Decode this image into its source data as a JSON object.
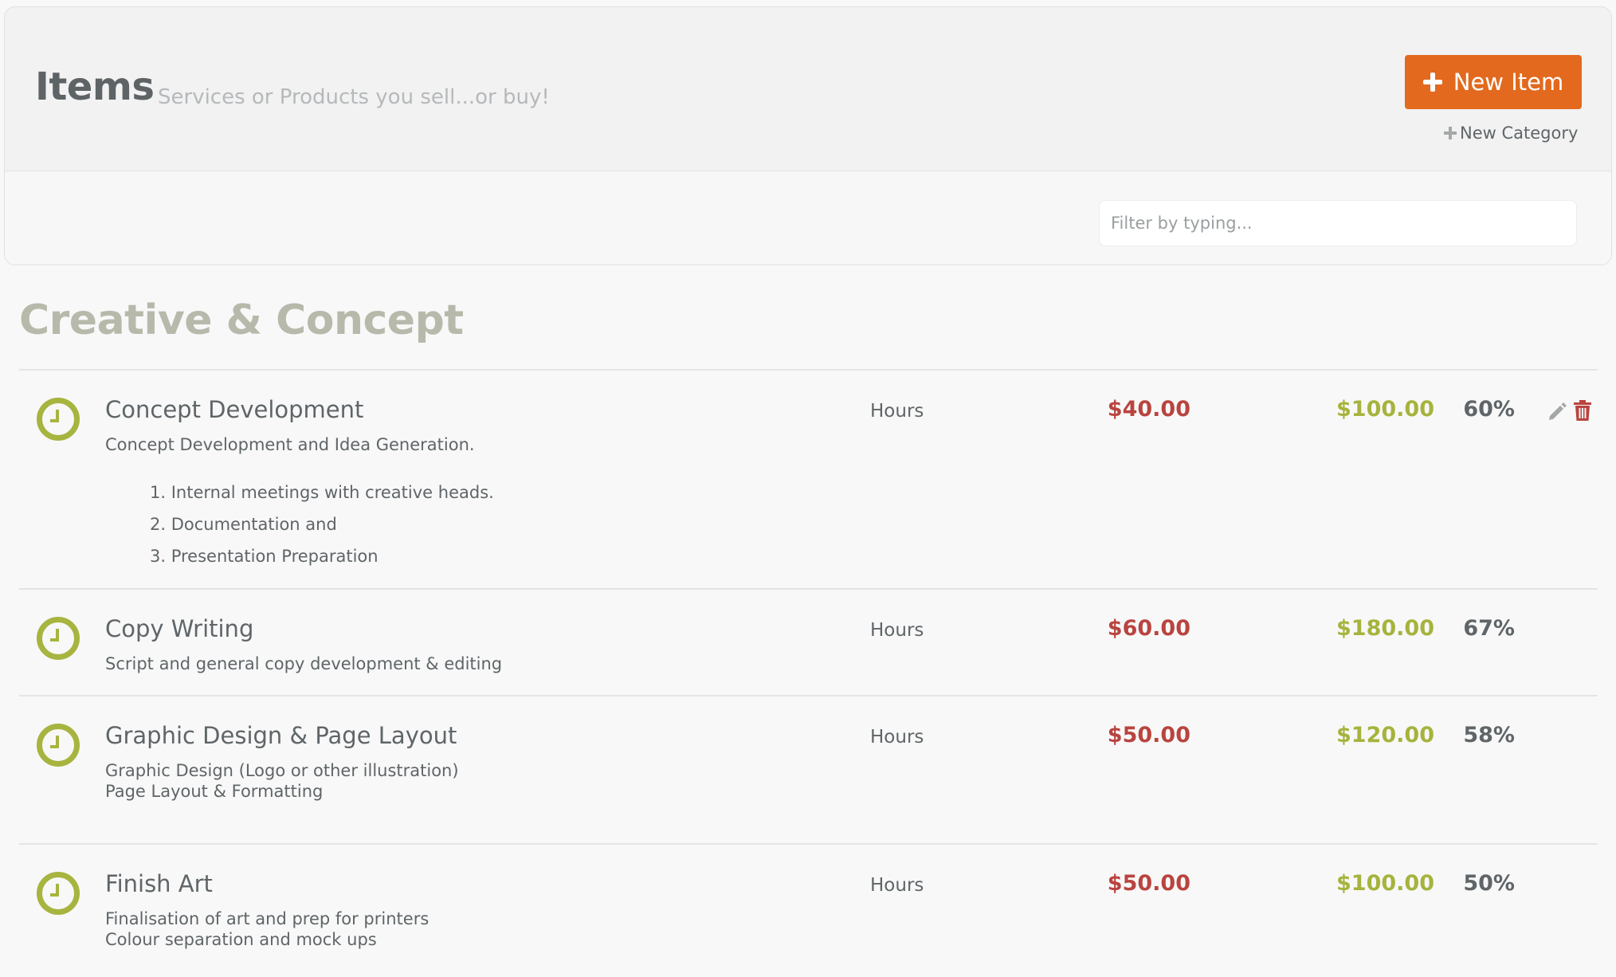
{
  "header": {
    "title": "Items",
    "subtitle": "Services or Products you sell...or buy!",
    "new_item_label": "New Item",
    "new_category_label": "New Category"
  },
  "filter": {
    "placeholder": "Filter by typing..."
  },
  "category": {
    "title": "Creative & Concept",
    "items": [
      {
        "name": "Concept Development",
        "description": "Concept Development and Idea Generation.",
        "description_list": [
          "1. Internal meetings with creative heads.",
          "2. Documentation and",
          "3. Presentation Preparation"
        ],
        "unit": "Hours",
        "cost": "$40.00",
        "price": "$100.00",
        "margin": "60%",
        "icon": "clock-icon"
      },
      {
        "name": "Copy Writing",
        "description": "Script and general copy development & editing",
        "unit": "Hours",
        "cost": "$60.00",
        "price": "$180.00",
        "margin": "67%",
        "icon": "clock-icon"
      },
      {
        "name": "Graphic Design & Page Layout",
        "description_lines": [
          "Graphic Design (Logo or other illustration)",
          "Page Layout & Formatting"
        ],
        "unit": "Hours",
        "cost": "$50.00",
        "price": "$120.00",
        "margin": "58%",
        "icon": "clock-icon"
      },
      {
        "name": "Finish Art",
        "description_lines": [
          "Finalisation of art and prep for printers",
          "Colour separation and mock ups"
        ],
        "unit": "Hours",
        "cost": "$50.00",
        "price": "$100.00",
        "margin": "50%",
        "icon": "clock-icon"
      }
    ]
  },
  "colors": {
    "accent": "#e2691d",
    "cost": "#b9443f",
    "price": "#a6b33d",
    "icon": "#a7b43f",
    "category_title": "#b7b9ab"
  },
  "icons": {
    "edit": "pencil-icon",
    "delete": "trash-icon",
    "add": "plus-icon"
  }
}
